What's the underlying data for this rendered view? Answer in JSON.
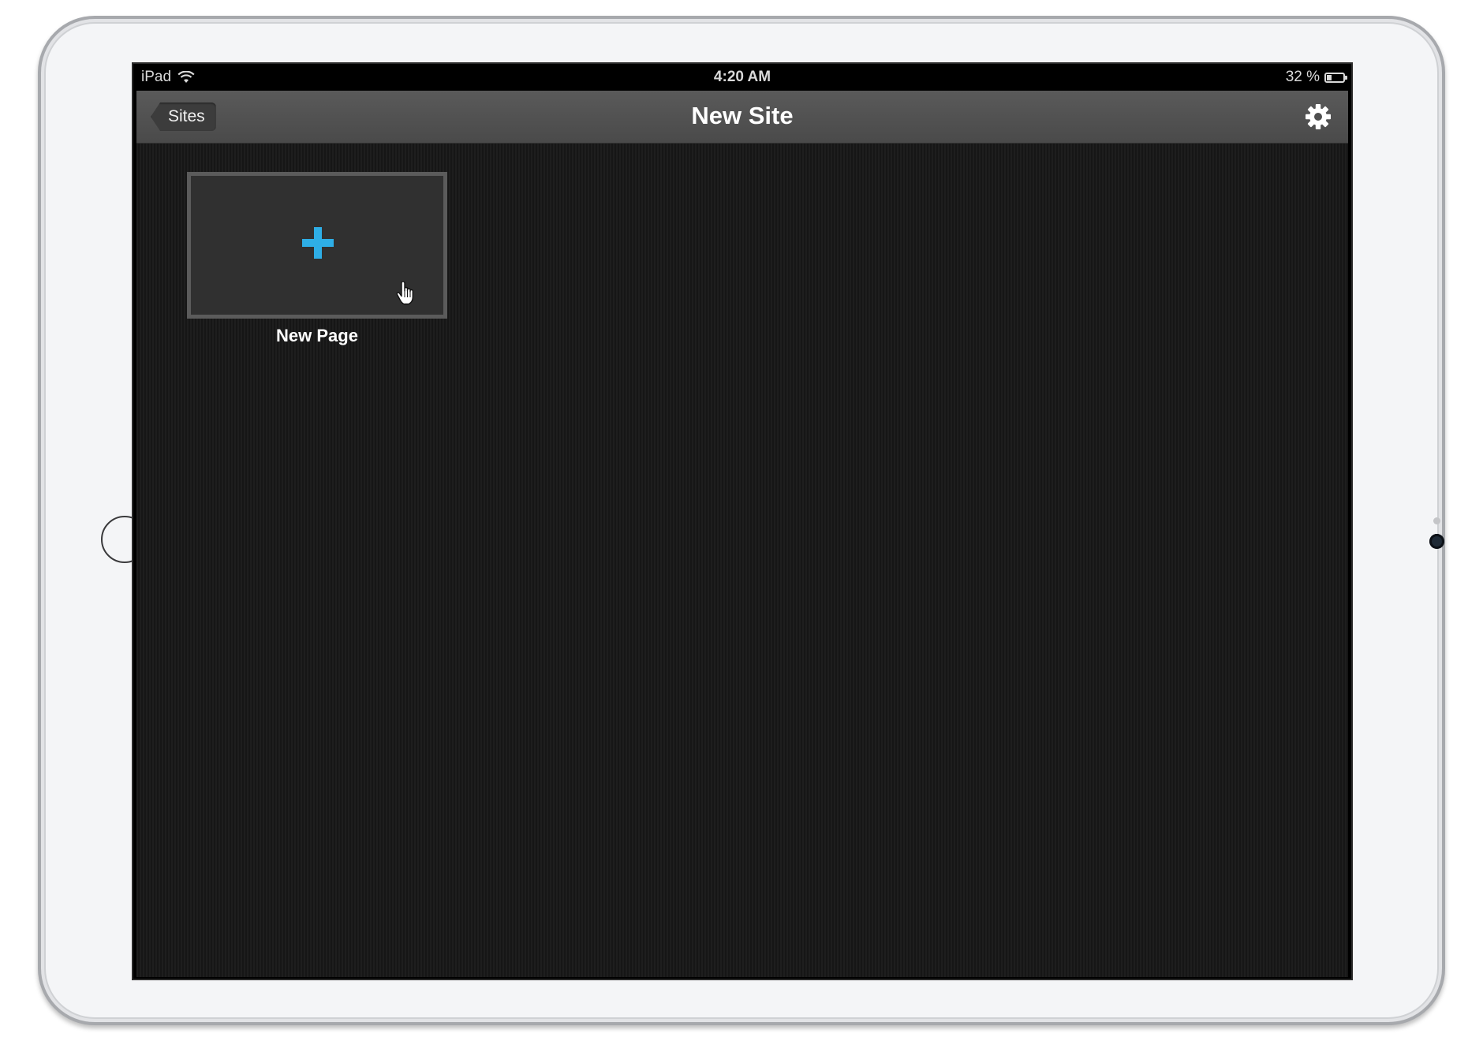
{
  "status_bar": {
    "device": "iPad",
    "time": "4:20 AM",
    "battery": "32 %",
    "battery_level": 0.32
  },
  "nav": {
    "back_label": "Sites",
    "title": "New Site",
    "settings_icon": "gear-icon"
  },
  "tiles": [
    {
      "label": "New Page",
      "icon": "plus-icon",
      "accent": "#2eaee6"
    }
  ],
  "colors": {
    "nav_bar": "#4f4f4f",
    "background": "#1c1c1c",
    "accent": "#2eaee6"
  }
}
